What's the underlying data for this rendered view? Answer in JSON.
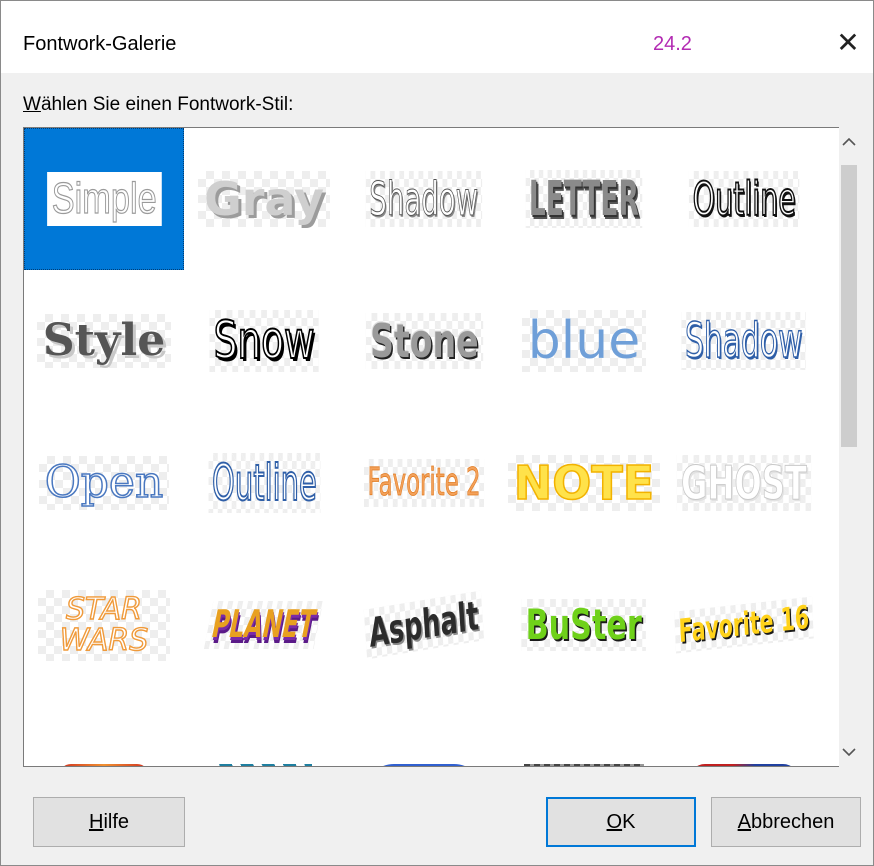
{
  "window": {
    "title": "Fontwork-Galerie",
    "version": "24.2",
    "close_glyph": "✕"
  },
  "prompt": {
    "accel": "W",
    "rest": "ählen Sie einen Fontwork-Stil:"
  },
  "colors": {
    "selection": "#0078d7",
    "version_text": "#b32bb3"
  },
  "gallery": {
    "selected_index": 0,
    "items": [
      {
        "label": "Simple"
      },
      {
        "label": "Gray"
      },
      {
        "label": "Shadow"
      },
      {
        "label": "LETTER"
      },
      {
        "label": "Outline"
      },
      {
        "label": "Style"
      },
      {
        "label": "Snow"
      },
      {
        "label": "Stone"
      },
      {
        "label": "blue"
      },
      {
        "label": "Shadow"
      },
      {
        "label": "Open"
      },
      {
        "label": "Outline"
      },
      {
        "label": "Favorite 2"
      },
      {
        "label": "NOTE"
      },
      {
        "label": "GHOST"
      },
      {
        "label": "STAR WARS"
      },
      {
        "label": "PLANET"
      },
      {
        "label": "Asphalt"
      },
      {
        "label": "BuSter"
      },
      {
        "label": "Favorite 16"
      }
    ]
  },
  "scrollbar": {
    "up_icon": "chevron-up-icon",
    "down_icon": "chevron-down-icon"
  },
  "buttons": {
    "help": {
      "accel": "H",
      "rest": "ilfe"
    },
    "ok": {
      "accel": "O",
      "rest": "K"
    },
    "cancel": {
      "accel": "A",
      "rest": "bbrechen"
    }
  }
}
